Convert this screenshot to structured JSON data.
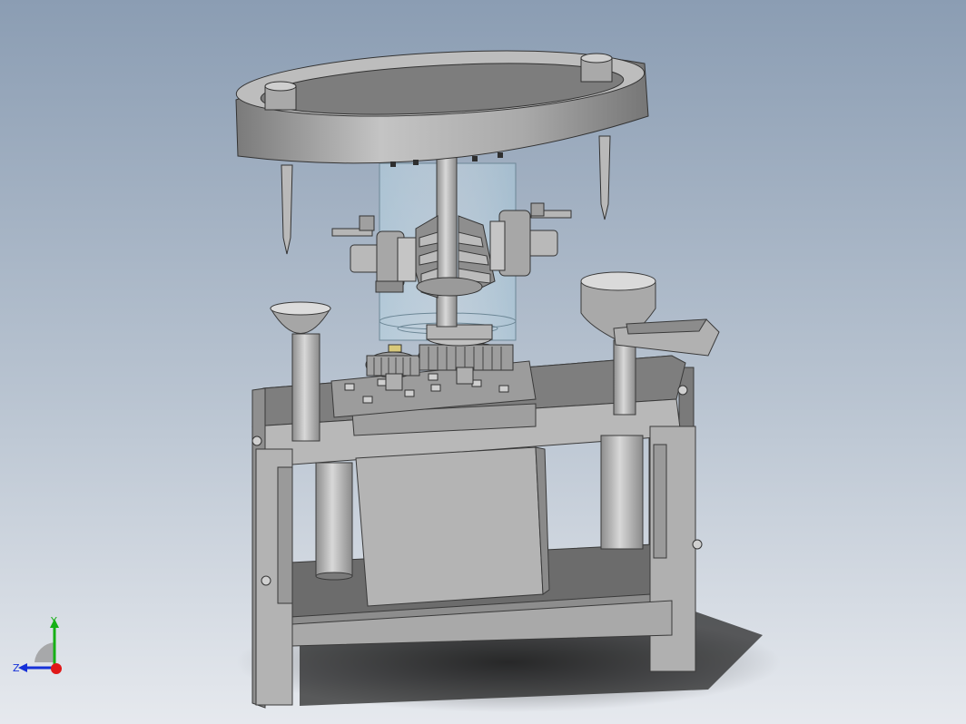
{
  "viewport": {
    "background_top": "#8b9db3",
    "background_bottom": "#e6e9ee"
  },
  "triad": {
    "y_label": "Y",
    "z_label": "Z",
    "x_color": "#e01818",
    "y_color": "#16b016",
    "z_color": "#1530d8"
  },
  "model": {
    "colors": {
      "metal_light": "#c9c9c9",
      "metal_mid": "#a7a7a7",
      "metal_dark": "#6e6e6e",
      "glass": "#c8e2ef"
    }
  }
}
